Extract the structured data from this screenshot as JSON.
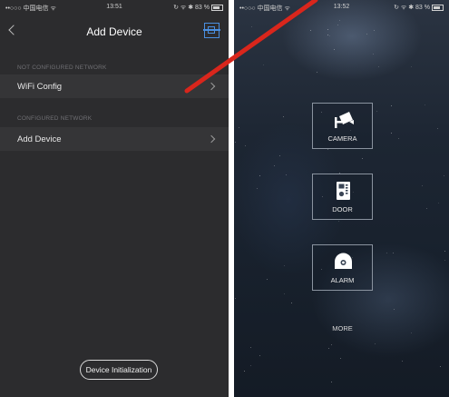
{
  "left_screen": {
    "status": {
      "carrier": "••○○○ 中国电信 ᯤ",
      "time": "13:51",
      "indicators": "↻ ᯤ ✱ 83 %"
    },
    "nav": {
      "title": "Add Device",
      "back_icon": "chevron-left-icon",
      "action_icon": "qr-scan-icon",
      "action_color": "#4a8fe0"
    },
    "sections": [
      {
        "label": "NOT CONFIGURED NETWORK",
        "row_label": "WiFi Config"
      },
      {
        "label": "CONFIGURED NETWORK",
        "row_label": "Add Device"
      }
    ],
    "footer_button": "Device Initialization"
  },
  "right_screen": {
    "status": {
      "carrier": "••○○○ 中国电信 ᯤ",
      "time": "13:52",
      "indicators": "↻ ᯤ ✱ 83 %"
    },
    "tiles": [
      {
        "label": "CAMERA",
        "icon": "cctv-camera-icon"
      },
      {
        "label": "DOOR",
        "icon": "door-intercom-icon"
      },
      {
        "label": "ALARM",
        "icon": "alarm-siren-icon"
      }
    ],
    "more": "MORE"
  },
  "annotation": {
    "arrow_color": "#d9261c"
  }
}
